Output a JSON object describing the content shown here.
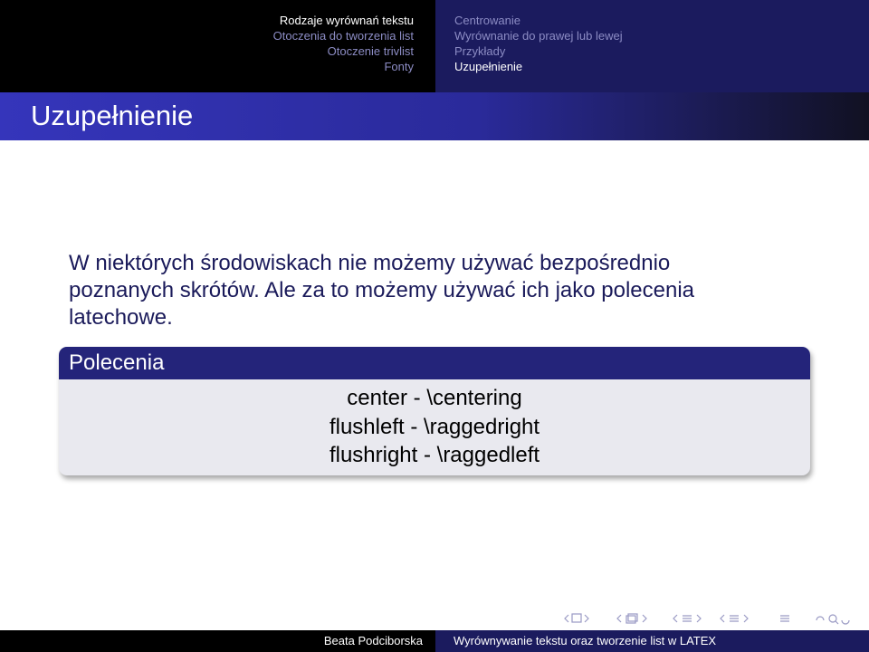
{
  "navigation": {
    "sections": [
      {
        "label": "Rodzaje wyrównań tekstu",
        "active": true
      },
      {
        "label": "Otoczenia do tworzenia list",
        "active": false
      },
      {
        "label": "Otoczenie trivlist",
        "active": false
      },
      {
        "label": "Fonty",
        "active": false
      }
    ],
    "subsections": [
      {
        "label": "Centrowanie",
        "active": false
      },
      {
        "label": "Wyrównanie do prawej lub lewej",
        "active": false
      },
      {
        "label": "Przykłady",
        "active": false
      },
      {
        "label": "Uzupełnienie",
        "active": true
      }
    ]
  },
  "frame": {
    "title": "Uzupełnienie",
    "body_lines": [
      "W niektórych środowiskach nie możemy używać bezpośrednio",
      "poznanych skrótów. Ale za to możemy używać ich jako polecenia",
      "latechowe."
    ],
    "block": {
      "title": "Polecenia",
      "lines": [
        "center - \\centering",
        "flushleft - \\raggedright",
        "flushright - \\raggedleft"
      ]
    }
  },
  "footer": {
    "author": "Beata Podciborska",
    "title": "Wyrównywanie tekstu oraz tworzenie list w LATEX"
  },
  "colors": {
    "structure": "#24247a",
    "nav_inactive": "#8c8cc4",
    "text": "#1a1a5a",
    "block_bg": "#e9e9ef"
  },
  "icons": [
    "nav-frame-icon",
    "nav-subsection-icon",
    "nav-section-icon",
    "nav-document-icon",
    "nav-align-icon",
    "nav-search-icon"
  ]
}
